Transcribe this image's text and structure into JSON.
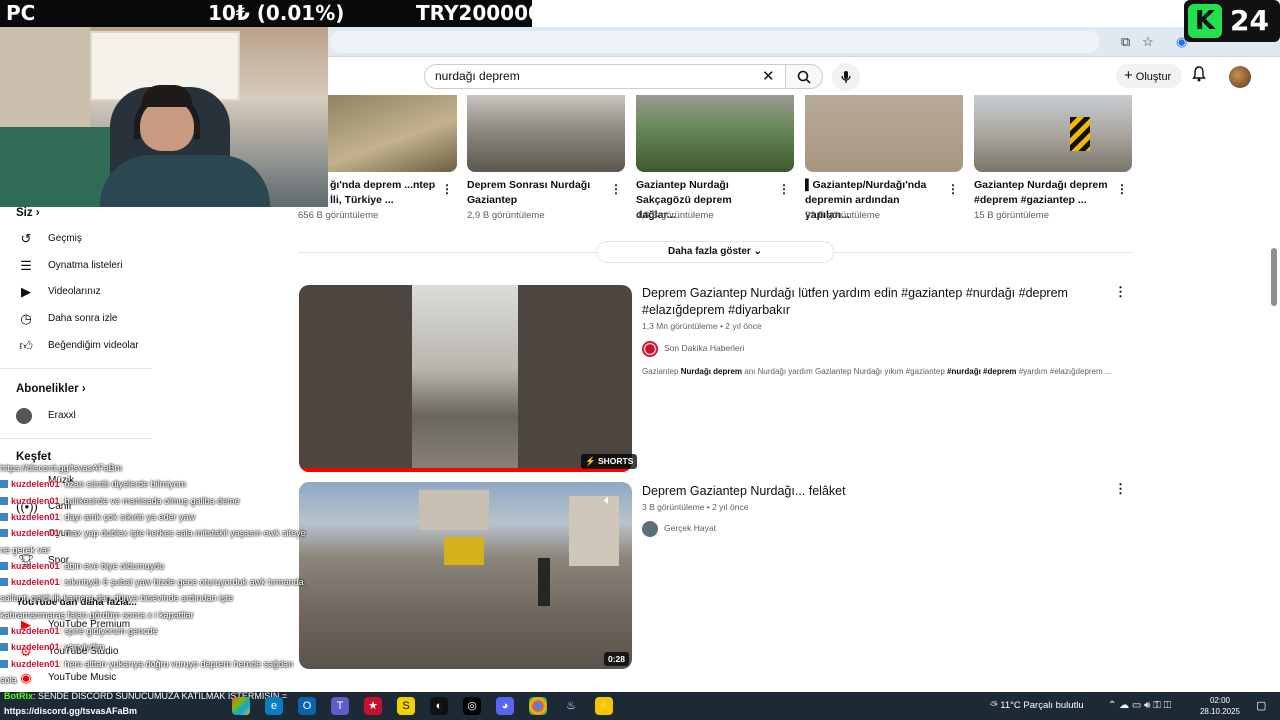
{
  "overlay": {
    "left": "PC",
    "mid": "10₺ (0.01%)",
    "right": "TRY200000",
    "logo_k": "K",
    "logo_num": "24"
  },
  "header": {
    "search_value": "nurdağı deprem",
    "create_label": "Oluştur"
  },
  "sidebar": {
    "you_label": "Siz",
    "you_items": [
      "Geçmiş",
      "Oynatma listeleri",
      "Videolarınız",
      "Daha sonra izle",
      "Beğendiğim videolar"
    ],
    "subs_label": "Abonelikler",
    "subs_items": [
      "Eraxxl"
    ],
    "explore_label": "Keşfet",
    "explore_items": [
      "Müzik",
      "Canlı",
      "Oyun",
      "Spor"
    ],
    "more_label": "YouTube'dan daha fazla...",
    "more_items": [
      "YouTube Premium",
      "YouTube Studio",
      "YouTube Music"
    ]
  },
  "shelf": [
    {
      "title": "ğı'nda deprem ...ntep İli, Türkiye ...",
      "views": "656 B görüntüleme"
    },
    {
      "title": "Deprem Sonrası Nurdağı Gaziantep",
      "views": "2,9 B görüntüleme"
    },
    {
      "title": "Gaziantep Nurdağı Sakçagözü deprem dağlar...",
      "views": "4,8 B görüntüleme"
    },
    {
      "title": "▌Gaziantep/Nurdağı'nda depremin ardından yapılan...",
      "views": "92 B görüntüleme"
    },
    {
      "title": "Gaziantep Nurdağı deprem #deprem #gaziantep ...",
      "views": "15 B görüntüleme"
    }
  ],
  "show_more": "Daha fazla göster",
  "results": [
    {
      "title": "Deprem Gaziantep Nurdağı lütfen yardım edin #gaziantep #nurdağı #deprem #elazığdeprem #diyarbakır",
      "meta": "1,3 Mn görüntüleme • 2 yıl önce",
      "channel": "Son Dakika Haberleri",
      "desc_pre": "Gaziantep ",
      "desc_bold1": "Nurdağı deprem",
      "desc_mid": " anı Nurdağı yardım Gaziantep Nurdağı yıkım #gaziantep ",
      "desc_bold2": "#nurdağı #deprem",
      "desc_post": " #yardım #elazığdeprem ...",
      "badge": "⚡ SHORTS"
    },
    {
      "title": "Deprem Gaziantep Nurdağı... felâket",
      "meta": "3 B görüntüleme • 2 yıl önce",
      "channel": "Gerçek Hayat",
      "duration": "0:28"
    }
  ],
  "chat": [
    {
      "name": "",
      "msg": "https://discord.gg/tsvasAFaBm"
    },
    {
      "name": "kuzdelen01",
      "msg": ": ozan sürdü diyelerde bilmiyom"
    },
    {
      "name": "kuzdelen01",
      "msg": ": balıkesirde ve manisada olmuş galiba deme"
    },
    {
      "name": "kuzdelen01",
      "msg": ": dayı amk çok sıkıntı ya eder yaw"
    },
    {
      "name": "kuzdelen01",
      "msg": ": max yap dublex işte herkes sala mitstakil yaşasın ewk siteye"
    },
    {
      "name": "",
      "msg": "ne gerek var"
    },
    {
      "name": "kuzdelen01",
      "msg": ": abin eve biye oldumuydu"
    },
    {
      "name": "kuzdelen01",
      "msg": ": sıkıntıydı 6 şubat yaw bizde gece oturuyorduk awk tırmanda"
    },
    {
      "name": "",
      "msg": "sallantı geldi ilk kamera dan dünya bisevinde ardından işte"
    },
    {
      "name": "",
      "msg": "kahramanmaraş falan gördüm sonra x i kapattlar"
    },
    {
      "name": "kuzdelen01",
      "msg": ": spire gidiyorum gencde"
    },
    {
      "name": "kuzdelen01",
      "msg": ": yanyiydim"
    },
    {
      "name": "kuzdelen01",
      "msg": ": hem alttan yukarıya doğru vuruyo deprem hemde sağdan"
    },
    {
      "name": "",
      "msg": "sola"
    }
  ],
  "botrix": {
    "label": "BotRix",
    "msg": ": SENDE DİSCORD SUNUCUMUZA KATILMAK İSTERMİSİN =",
    "link": "https://discord.gg/tsvasAFaBm"
  },
  "taskbar": {
    "weather": "11°C  Parçalı bulutlu",
    "time": "02:00",
    "date": "28.10.2025"
  }
}
